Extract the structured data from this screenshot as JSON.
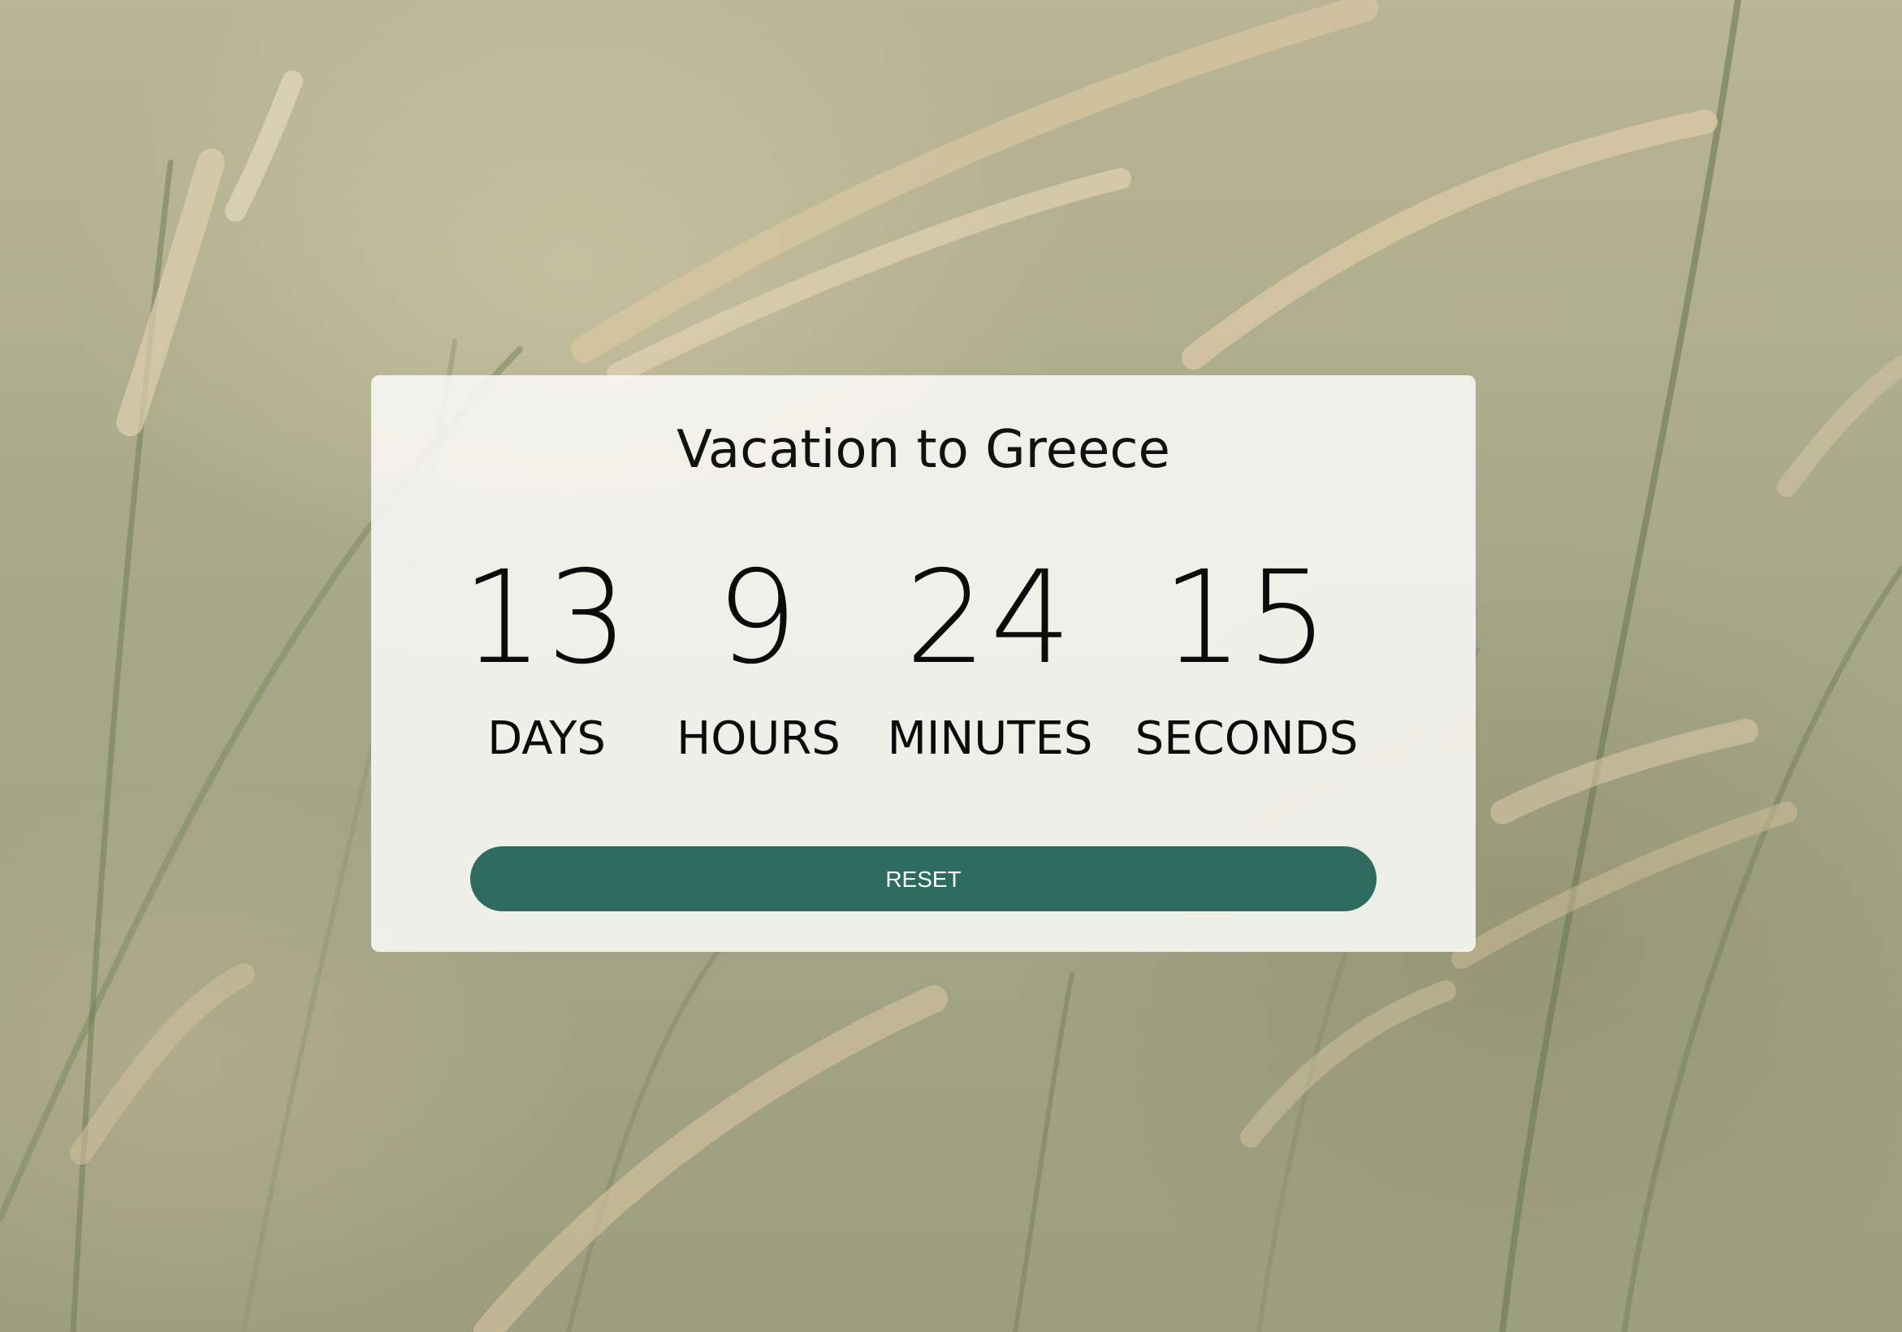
{
  "countdown": {
    "title": "Vacation to Greece",
    "days": {
      "value": "13",
      "label": "DAYS"
    },
    "hours": {
      "value": "9",
      "label": "HOURS"
    },
    "minutes": {
      "value": "24",
      "label": "MINUTES"
    },
    "seconds": {
      "value": "15",
      "label": "SECONDS"
    },
    "reset_label": "RESET"
  },
  "colors": {
    "button": "#2d6b5e",
    "card": "#f7f7f4",
    "text": "#111111"
  }
}
